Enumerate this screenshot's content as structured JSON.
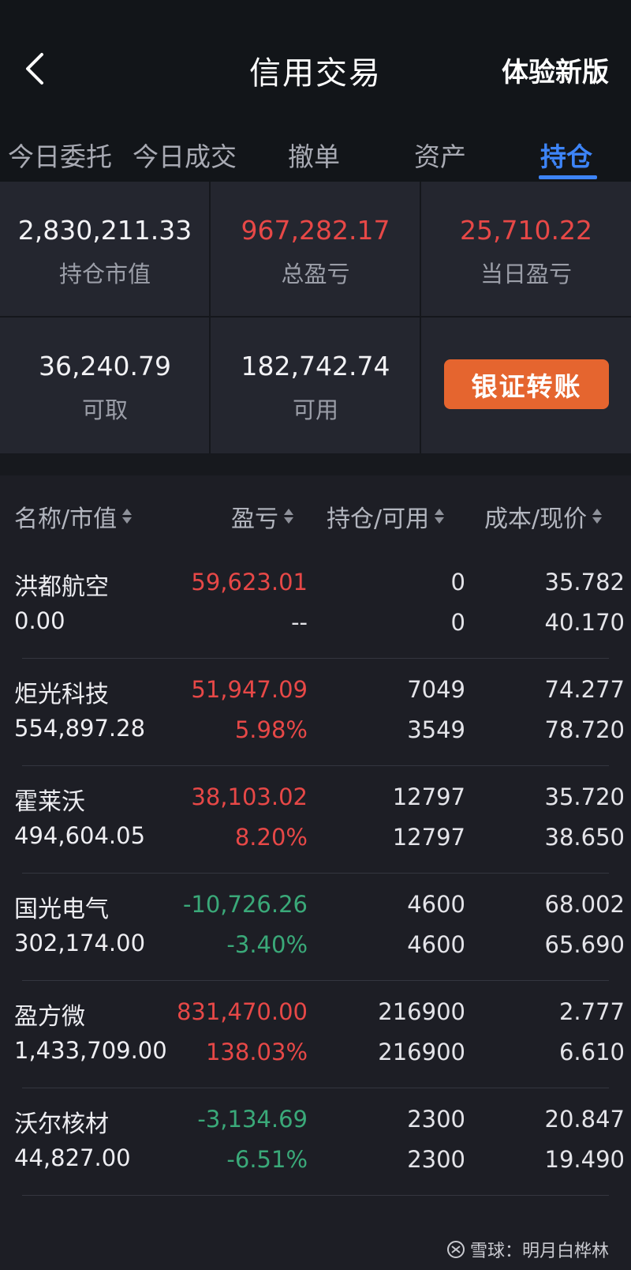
{
  "header": {
    "title": "信用交易",
    "new_version": "体验新版"
  },
  "tabs": [
    {
      "label": "今日委托"
    },
    {
      "label": "今日成交"
    },
    {
      "label": "撤单"
    },
    {
      "label": "资产"
    },
    {
      "label": "持仓"
    }
  ],
  "summary": {
    "market_value": {
      "value": "2,830,211.33",
      "label": "持仓市值"
    },
    "total_pl": {
      "value": "967,282.17",
      "label": "总盈亏"
    },
    "daily_pl": {
      "value": "25,710.22",
      "label": "当日盈亏"
    },
    "withdrawable": {
      "value": "36,240.79",
      "label": "可取"
    },
    "available": {
      "value": "182,742.74",
      "label": "可用"
    },
    "transfer_button": "银证转账"
  },
  "table": {
    "headers": {
      "name": "名称/市值",
      "pl": "盈亏",
      "position": "持仓/可用",
      "cost": "成本/现价"
    },
    "rows": [
      {
        "name": "洪都航空",
        "market_value": "0.00",
        "pl": "59,623.01",
        "pl_pct": "--",
        "position": "0",
        "available": "0",
        "cost": "35.782",
        "price": "40.170"
      },
      {
        "name": "炬光科技",
        "market_value": "554,897.28",
        "pl": "51,947.09",
        "pl_pct": "5.98%",
        "position": "7049",
        "available": "3549",
        "cost": "74.277",
        "price": "78.720"
      },
      {
        "name": "霍莱沃",
        "market_value": "494,604.05",
        "pl": "38,103.02",
        "pl_pct": "8.20%",
        "position": "12797",
        "available": "12797",
        "cost": "35.720",
        "price": "38.650"
      },
      {
        "name": "国光电气",
        "market_value": "302,174.00",
        "pl": "-10,726.26",
        "pl_pct": "-3.40%",
        "position": "4600",
        "available": "4600",
        "cost": "68.002",
        "price": "65.690"
      },
      {
        "name": "盈方微",
        "market_value": "1,433,709.00",
        "pl": "831,470.00",
        "pl_pct": "138.03%",
        "position": "216900",
        "available": "216900",
        "cost": "2.777",
        "price": "6.610"
      },
      {
        "name": "沃尔核材",
        "market_value": "44,827.00",
        "pl": "-3,134.69",
        "pl_pct": "-6.51%",
        "position": "2300",
        "available": "2300",
        "cost": "20.847",
        "price": "19.490"
      }
    ]
  },
  "watermark": {
    "text": "雪球：明月白桦林"
  },
  "colors": {
    "gain": "#e74847",
    "loss": "#3aa979",
    "accent": "#3d84f7",
    "button": "#e5652f"
  }
}
